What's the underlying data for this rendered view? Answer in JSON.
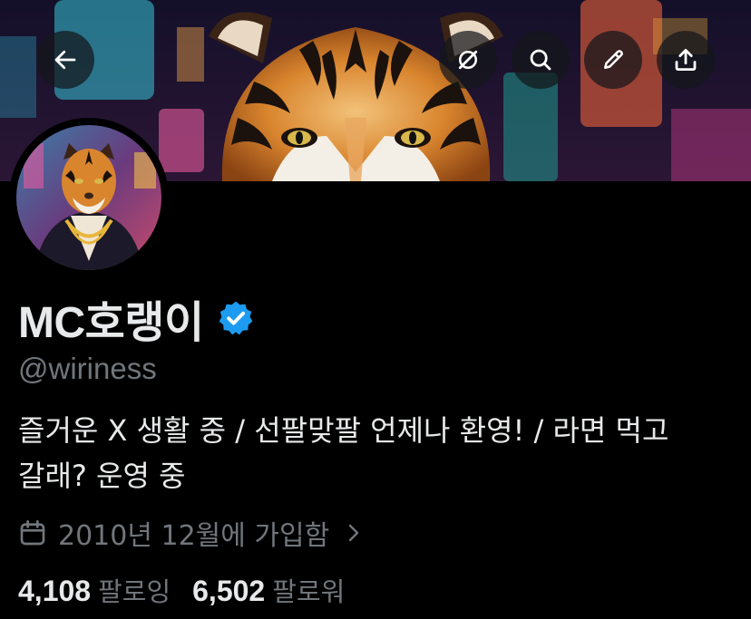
{
  "header": {
    "back_icon": "arrow-left-icon",
    "grok_icon": "grok-slash-icon",
    "search_icon": "search-icon",
    "edit_icon": "pencil-icon",
    "share_icon": "share-upload-icon",
    "banner_description_image": "tiger-neon-city-banner"
  },
  "profile": {
    "display_name": "MC호랭이",
    "verified": true,
    "verified_color": "#1d9bf0",
    "handle": "@wiriness",
    "bio_line1": "즐거운 X 생활 중 / 선팔맞팔 언제나 환영! / 라면 먹고",
    "bio_line2": "갈래? 운영 중",
    "joined": "2010년 12월에 가입함",
    "following_count": "4,108",
    "following_label": "팔로잉",
    "followers_count": "6,502",
    "followers_label": "팔로워"
  },
  "colors": {
    "background": "#000000",
    "primary_text": "#e7e9ea",
    "secondary_text": "#71767b",
    "accent": "#1d9bf0"
  }
}
